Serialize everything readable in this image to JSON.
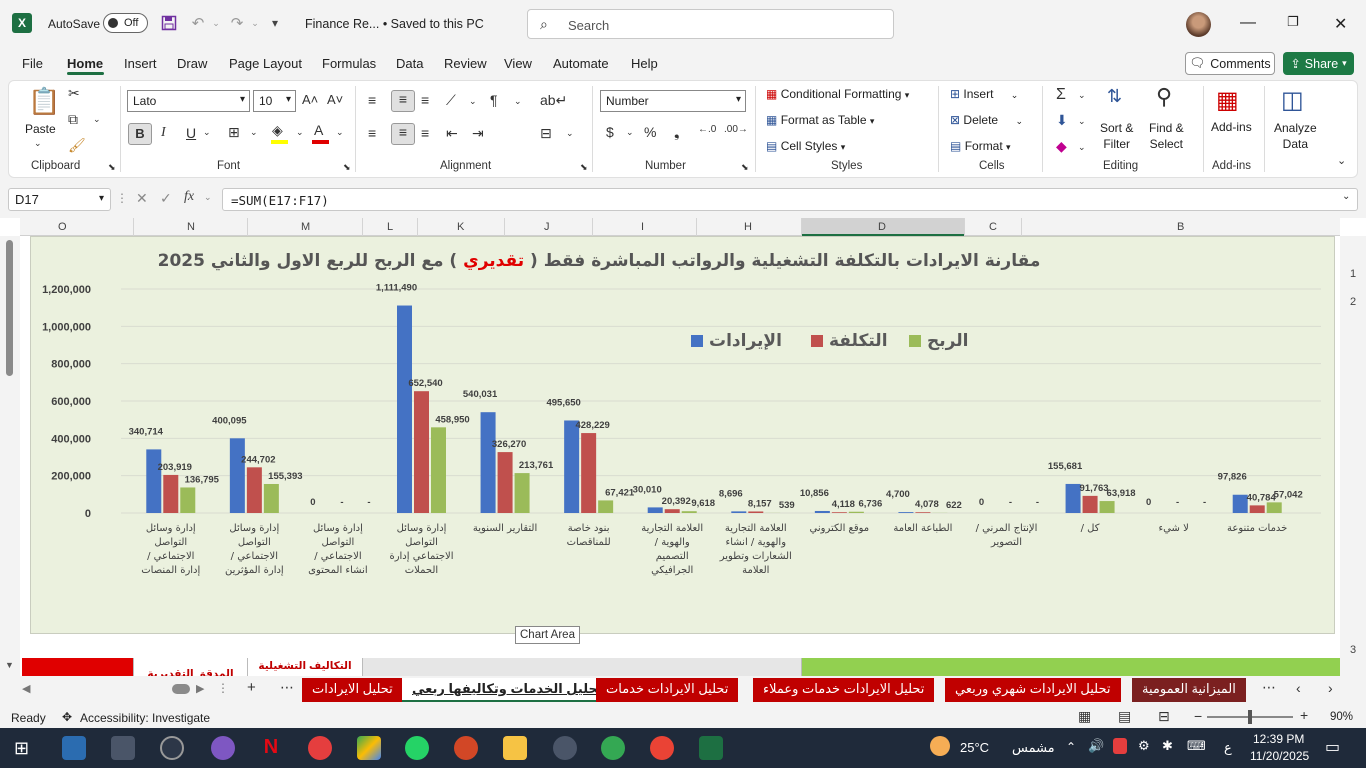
{
  "titlebar": {
    "autosave_label": "AutoSave",
    "autosave_state": "Off",
    "doc_title": "Finance Re... • Saved to this PC",
    "search_placeholder": "Search"
  },
  "menu": [
    "File",
    "Home",
    "Insert",
    "Draw",
    "Page Layout",
    "Formulas",
    "Data",
    "Review",
    "View",
    "Automate",
    "Help"
  ],
  "comments_label": "Comments",
  "share_label": "Share",
  "ribbon": {
    "clipboard": {
      "paste": "Paste",
      "label": "Clipboard"
    },
    "font": {
      "name": "Lato",
      "size": "10",
      "label": "Font"
    },
    "alignment": {
      "label": "Alignment"
    },
    "number": {
      "format": "Number",
      "label": "Number"
    },
    "styles": {
      "conditional": "Conditional Formatting",
      "format_table": "Format as Table",
      "cell_styles": "Cell Styles",
      "label": "Styles"
    },
    "cells": {
      "insert": "Insert",
      "delete": "Delete",
      "format": "Format",
      "label": "Cells"
    },
    "editing": {
      "sort": "Sort &\nFilter",
      "find": "Find &\nSelect",
      "label": "Editing"
    },
    "addins": {
      "addins": "Add-ins",
      "label": "Add-ins"
    },
    "analyze": {
      "label": "Analyze\nData"
    }
  },
  "formula_bar": {
    "name_box": "D17",
    "formula": "=SUM(E17:F17)"
  },
  "columns": [
    "O",
    "N",
    "M",
    "L",
    "K",
    "J",
    "I",
    "H",
    "D",
    "C",
    "B"
  ],
  "rows": [
    "1",
    "2",
    "3"
  ],
  "chart_tip": "Chart Area",
  "chart_data": {
    "type": "bar",
    "title": "مقارنة الايرادات بالتكلفة التشغيلية والرواتب المباشرة فقط ( تقديري ) مع الربح للربع الاول والثاني 2025",
    "title_prefix": "مقارنة الايرادات بالتكلفة التشغيلية والرواتب المباشرة فقط (",
    "title_highlight": " تقديري ",
    "title_suffix": ") مع الربح للربع الاول والثاني 2025",
    "highlight_color": "#e00000",
    "ylim": [
      0,
      1200000
    ],
    "yticks": [
      "1,200,000",
      "1,000,000",
      "800,000",
      "600,000",
      "400,000",
      "200,000",
      "0"
    ],
    "legend_position": "top",
    "categories": [
      "إدارة وسائل التواصل الاجتماعي / إدارة المنصات",
      "إدارة وسائل التواصل الاجتماعي / إدارة المؤثرين",
      "إدارة وسائل التواصل الاجتماعي / انشاء المحتوى",
      "إدارة وسائل التواصل الاجتماعي إدارة الحملات",
      "التقارير السنوية",
      "بنود خاصة للمناقصات",
      "العلامة التجارية والهوية / التصميم الجرافيكي",
      "العلامة التجارية والهوية / انشاء الشعارات وتطوير العلامة",
      "موقع الكتروني",
      "الطباعة العامة",
      "الإنتاج المرني / التصوير",
      "كل /",
      "لا شيء",
      "خدمات متنوعة"
    ],
    "series": [
      {
        "name": "الإيرادات",
        "color": "#4472c4",
        "values": [
          340714,
          400095,
          0,
          1111490,
          540031,
          495650,
          30010,
          8696,
          10856,
          4700,
          0,
          155681,
          0,
          97826
        ]
      },
      {
        "name": "التكلفة",
        "color": "#c0504d",
        "values": [
          203919,
          244702,
          0,
          652540,
          326270,
          428229,
          20392,
          8157,
          4118,
          4078,
          0,
          91763,
          0,
          40784
        ]
      },
      {
        "name": "الربح",
        "color": "#9bbb59",
        "values": [
          136795,
          155393,
          0,
          458950,
          213761,
          67421,
          9618,
          539,
          6736,
          622,
          0,
          63918,
          0,
          57042
        ]
      }
    ],
    "labels": [
      [
        "340,714",
        "203,919",
        "136,795"
      ],
      [
        "400,095",
        "244,702",
        "155,393"
      ],
      [
        "0",
        "-",
        "-"
      ],
      [
        "1,111,490",
        "652,540",
        "458,950"
      ],
      [
        "540,031",
        "326,270",
        "213,761"
      ],
      [
        "495,650",
        "428,229",
        "67,421"
      ],
      [
        "30,010",
        "20,392",
        "9,618"
      ],
      [
        "8,696",
        "8,157",
        "539"
      ],
      [
        "10,856",
        "4,118",
        "6,736"
      ],
      [
        "4,700",
        "4,078",
        "622"
      ],
      [
        "0",
        "-",
        "-"
      ],
      [
        "155,681",
        "91,763",
        "63,918"
      ],
      [
        "0",
        "-",
        "-"
      ],
      [
        "97,826",
        "40,784",
        "57,042"
      ]
    ]
  },
  "bottom_cells": {
    "m": "التكاليف التشغيلية",
    "n": "المدقق التقديرية"
  },
  "tabs": [
    "تحليل الايرادات",
    "تحليل الخدمات وتكاليفها ربعي",
    "تحليل الايرادات خدمات",
    "تحليل الايرادات خدمات وعملاء",
    "تحليل الايرادات شهري وربعي",
    "الميزانية العمومية"
  ],
  "status": {
    "ready": "Ready",
    "accessibility": "Accessibility: Investigate",
    "zoom": "90%"
  },
  "taskbar": {
    "temp": "25°C",
    "weather": "مشمس",
    "lang": "ع",
    "time": "12:39 PM",
    "date": "11/20/2025",
    "notif": "1"
  }
}
